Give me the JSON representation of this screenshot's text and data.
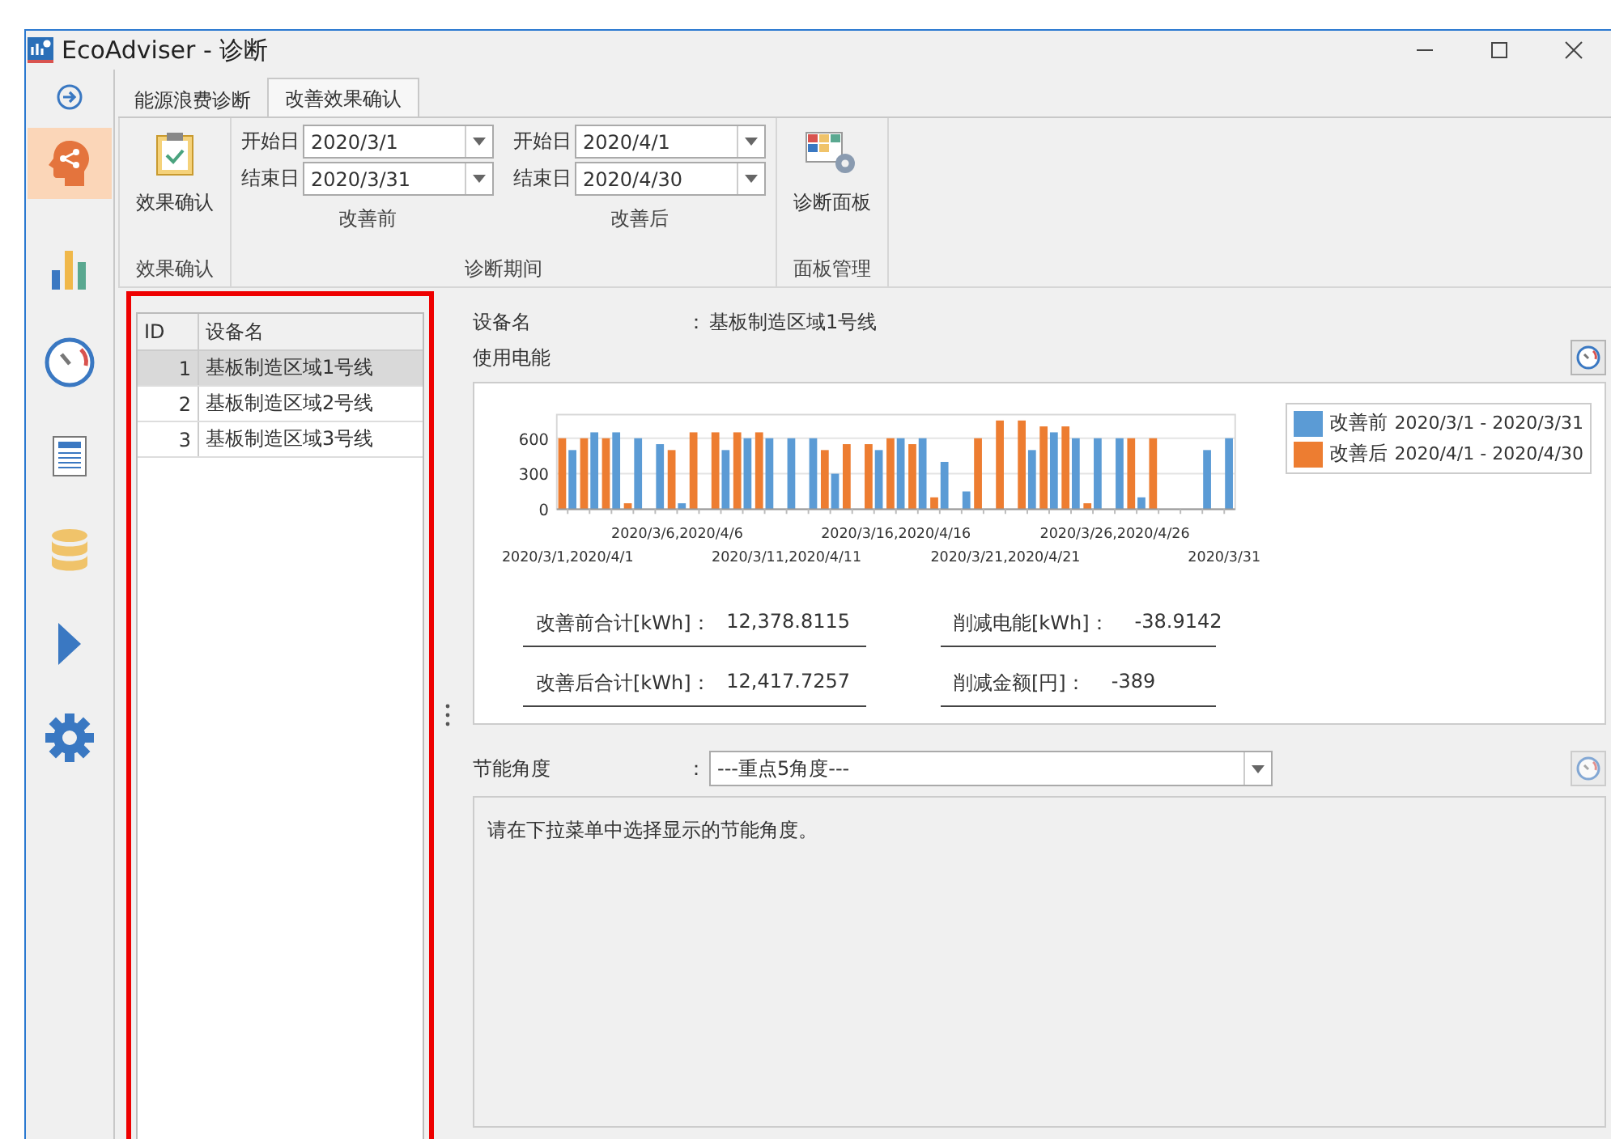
{
  "window": {
    "title": "EcoAdviser - 诊断"
  },
  "nav_rail": {
    "items": [
      {
        "kind": "expand",
        "selected": false
      },
      {
        "kind": "diagnosis",
        "selected": true
      },
      {
        "kind": "chart",
        "selected": false
      },
      {
        "kind": "gauge",
        "selected": false
      },
      {
        "kind": "report",
        "selected": false
      },
      {
        "kind": "database",
        "selected": false
      },
      {
        "kind": "run",
        "selected": false
      },
      {
        "kind": "settings",
        "selected": false
      }
    ]
  },
  "tabs": [
    {
      "label": "能源浪费诊断",
      "selected": false
    },
    {
      "label": "改善效果确认",
      "selected": true
    }
  ],
  "ribbon": {
    "groups": [
      {
        "kind": "confirm",
        "label": "效果确认",
        "button": "效果确认"
      },
      {
        "kind": "period",
        "label": "诊断期间",
        "periods": [
          {
            "caption": "改善前",
            "start_label": "开始日",
            "start": "2020/3/1",
            "end_label": "结束日",
            "end": "2020/3/31"
          },
          {
            "caption": "改善后",
            "start_label": "开始日",
            "start": "2020/4/1",
            "end_label": "结束日",
            "end": "2020/4/30"
          }
        ]
      },
      {
        "kind": "panel",
        "label": "面板管理",
        "button": "诊断面板"
      }
    ]
  },
  "device_table": {
    "columns": [
      "ID",
      "设备名"
    ],
    "rows": [
      {
        "id": "1",
        "name": "基板制造区域1号线",
        "selected": true
      },
      {
        "id": "2",
        "name": "基板制造区域2号线",
        "selected": false
      },
      {
        "id": "3",
        "name": "基板制造区域3号线",
        "selected": false
      }
    ]
  },
  "detail": {
    "device_label": "设备名",
    "device_colon": "：",
    "device_name": "基板制造区域1号线",
    "energy_label": "使用电能",
    "chart_data": {
      "type": "bar",
      "ylim": [
        0,
        800
      ],
      "yticks": [
        0,
        300,
        600
      ],
      "categories": [
        "2020/3/1,2020/4/1",
        null,
        null,
        null,
        null,
        "2020/3/6,2020/4/6",
        null,
        null,
        null,
        null,
        "2020/3/11,2020/4/11",
        null,
        null,
        null,
        null,
        "2020/3/16,2020/4/16",
        null,
        null,
        null,
        null,
        "2020/3/21,2020/4/21",
        null,
        null,
        null,
        null,
        "2020/3/26,2020/4/26",
        null,
        null,
        null,
        null,
        "2020/3/31"
      ],
      "series": [
        {
          "name": "改善前",
          "color": "#5b9bd5",
          "values": [
            500,
            650,
            650,
            600,
            550,
            50,
            0,
            500,
            600,
            600,
            600,
            600,
            300,
            0,
            500,
            600,
            600,
            400,
            150,
            0,
            0,
            500,
            650,
            600,
            600,
            600,
            100,
            0,
            0,
            500,
            600
          ]
        },
        {
          "name": "改善后",
          "color": "#ed7d31",
          "values": [
            600,
            600,
            600,
            50,
            0,
            500,
            650,
            650,
            650,
            650,
            0,
            0,
            500,
            550,
            550,
            600,
            550,
            100,
            0,
            600,
            750,
            750,
            700,
            700,
            50,
            0,
            600,
            600,
            0,
            0,
            null
          ]
        }
      ]
    },
    "legend_periods": [
      "2020/3/1 - 2020/3/31",
      "2020/4/1 - 2020/4/30"
    ],
    "stats": [
      {
        "label": "改善前合计[kWh]：",
        "value": "12,378.8115"
      },
      {
        "label": "削减电能[kWh]：",
        "value": "-38.9142"
      },
      {
        "label": "改善后合计[kWh]：",
        "value": "12,417.7257"
      },
      {
        "label": "削减金额[円]：",
        "value": "-389"
      }
    ]
  },
  "angle": {
    "label": "节能角度",
    "colon": "：",
    "select": "---重点5角度---",
    "message": "请在下拉菜单中选择显示的节能角度。"
  }
}
